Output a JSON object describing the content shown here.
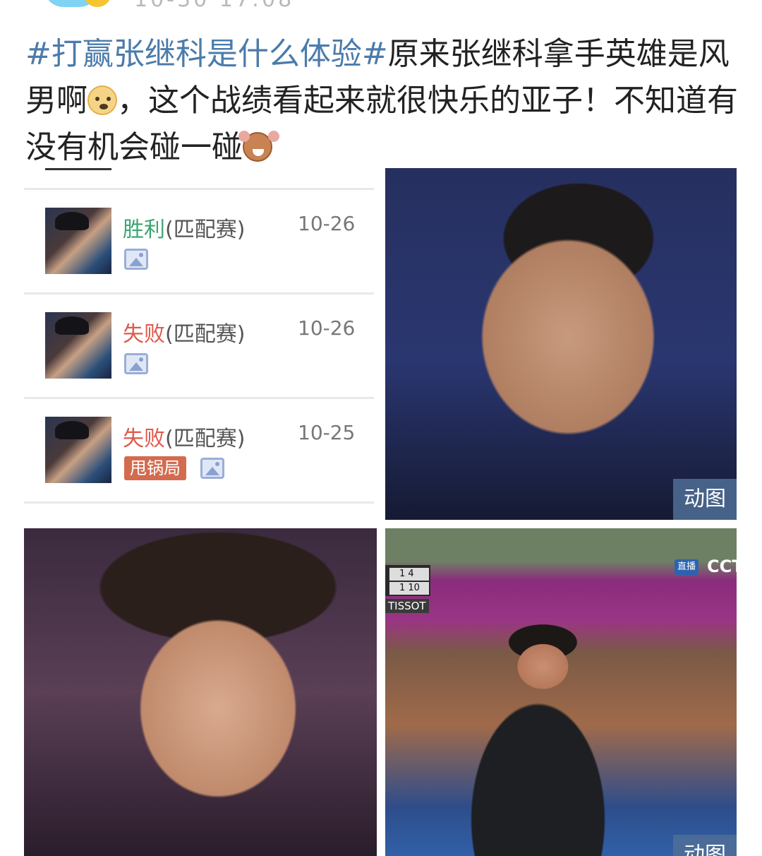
{
  "header": {
    "time_partial": "10-30 17:08"
  },
  "post": {
    "hashtag": "#打赢张继科是什么体验#",
    "text_1": "原来张继科拿手英雄是风男啊",
    "emoji_1": "doge",
    "text_2": "，这个战绩看起来就很快乐的亚子！不知道有没有机会碰一碰",
    "emoji_2": "jerry"
  },
  "match_records": [
    {
      "result": "胜利",
      "mode": "(匹配赛)",
      "date": "10-26",
      "status": "win"
    },
    {
      "result": "失败",
      "mode": "(匹配赛)",
      "date": "10-26",
      "status": "lose"
    },
    {
      "result": "失败",
      "mode": "(匹配赛)",
      "date": "10-25",
      "status": "lose",
      "tag": "甩锅局"
    }
  ],
  "images": {
    "gif_label": "动图"
  },
  "broadcast": {
    "score_top": "1 4",
    "score_bottom": "1 10",
    "sponsor": "TISSOT",
    "live": "直播",
    "channel": "CCT"
  },
  "colors": {
    "hashtag": "#4b7bab",
    "win": "#3aa670",
    "lose": "#e0594a",
    "tag_bg": "#d36b4f"
  }
}
